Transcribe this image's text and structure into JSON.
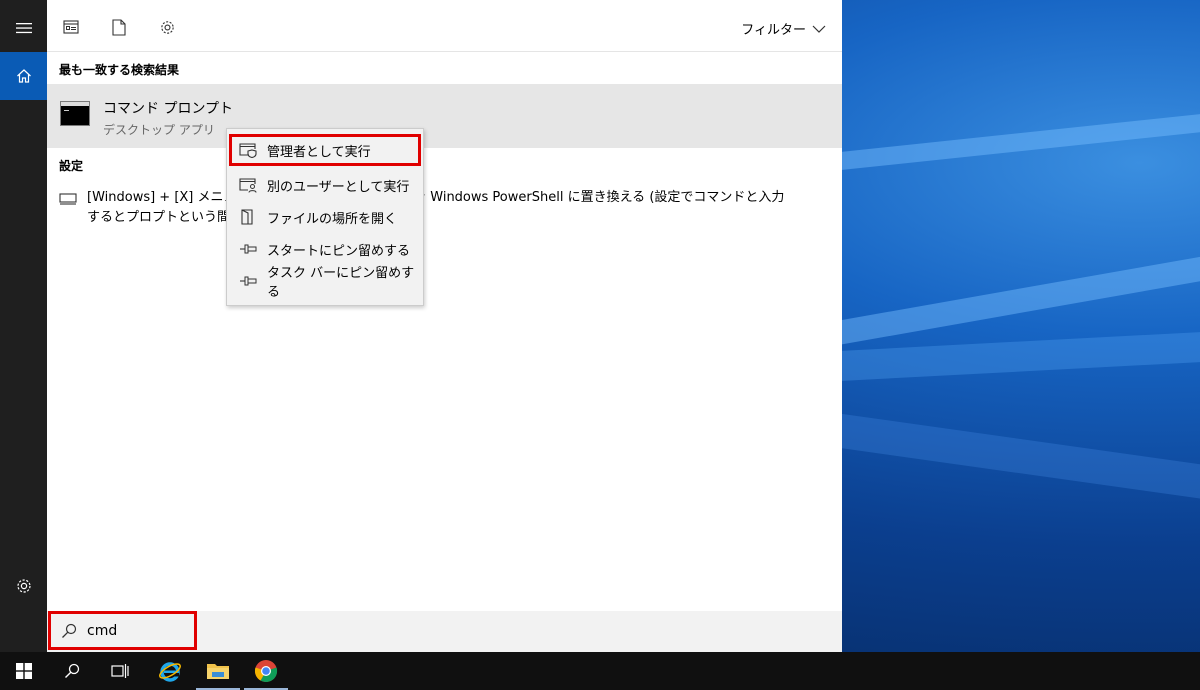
{
  "search_panel": {
    "filter_label": "フィルター",
    "best_match_heading": "最も一致する検索結果",
    "best_match": {
      "name": "コマンド プロンプト",
      "subtitle": "デスクトップ アプリ"
    },
    "settings_heading": "設定",
    "settings_result": {
      "line1": "[Windows] + [X] メニュ",
      "line1_tail": "ンプトを Windows PowerShell に置き換える (設定でコマンドと入力",
      "line2": "するとプロプトという間違"
    },
    "search_value": "cmd"
  },
  "context_menu": {
    "items": [
      {
        "label": "管理者として実行",
        "icon": "shield-window-icon"
      },
      {
        "label": "別のユーザーとして実行",
        "icon": "user-window-icon"
      },
      {
        "label": "ファイルの場所を開く",
        "icon": "folder-open-icon"
      },
      {
        "label": "スタートにピン留めする",
        "icon": "pin-icon"
      },
      {
        "label": "タスク バーにピン留めする",
        "icon": "pin-icon"
      }
    ]
  },
  "colors": {
    "accent": "#0a5bb5",
    "highlight": "#e00000",
    "rail": "#1f1f1f",
    "taskbar": "#101010"
  }
}
